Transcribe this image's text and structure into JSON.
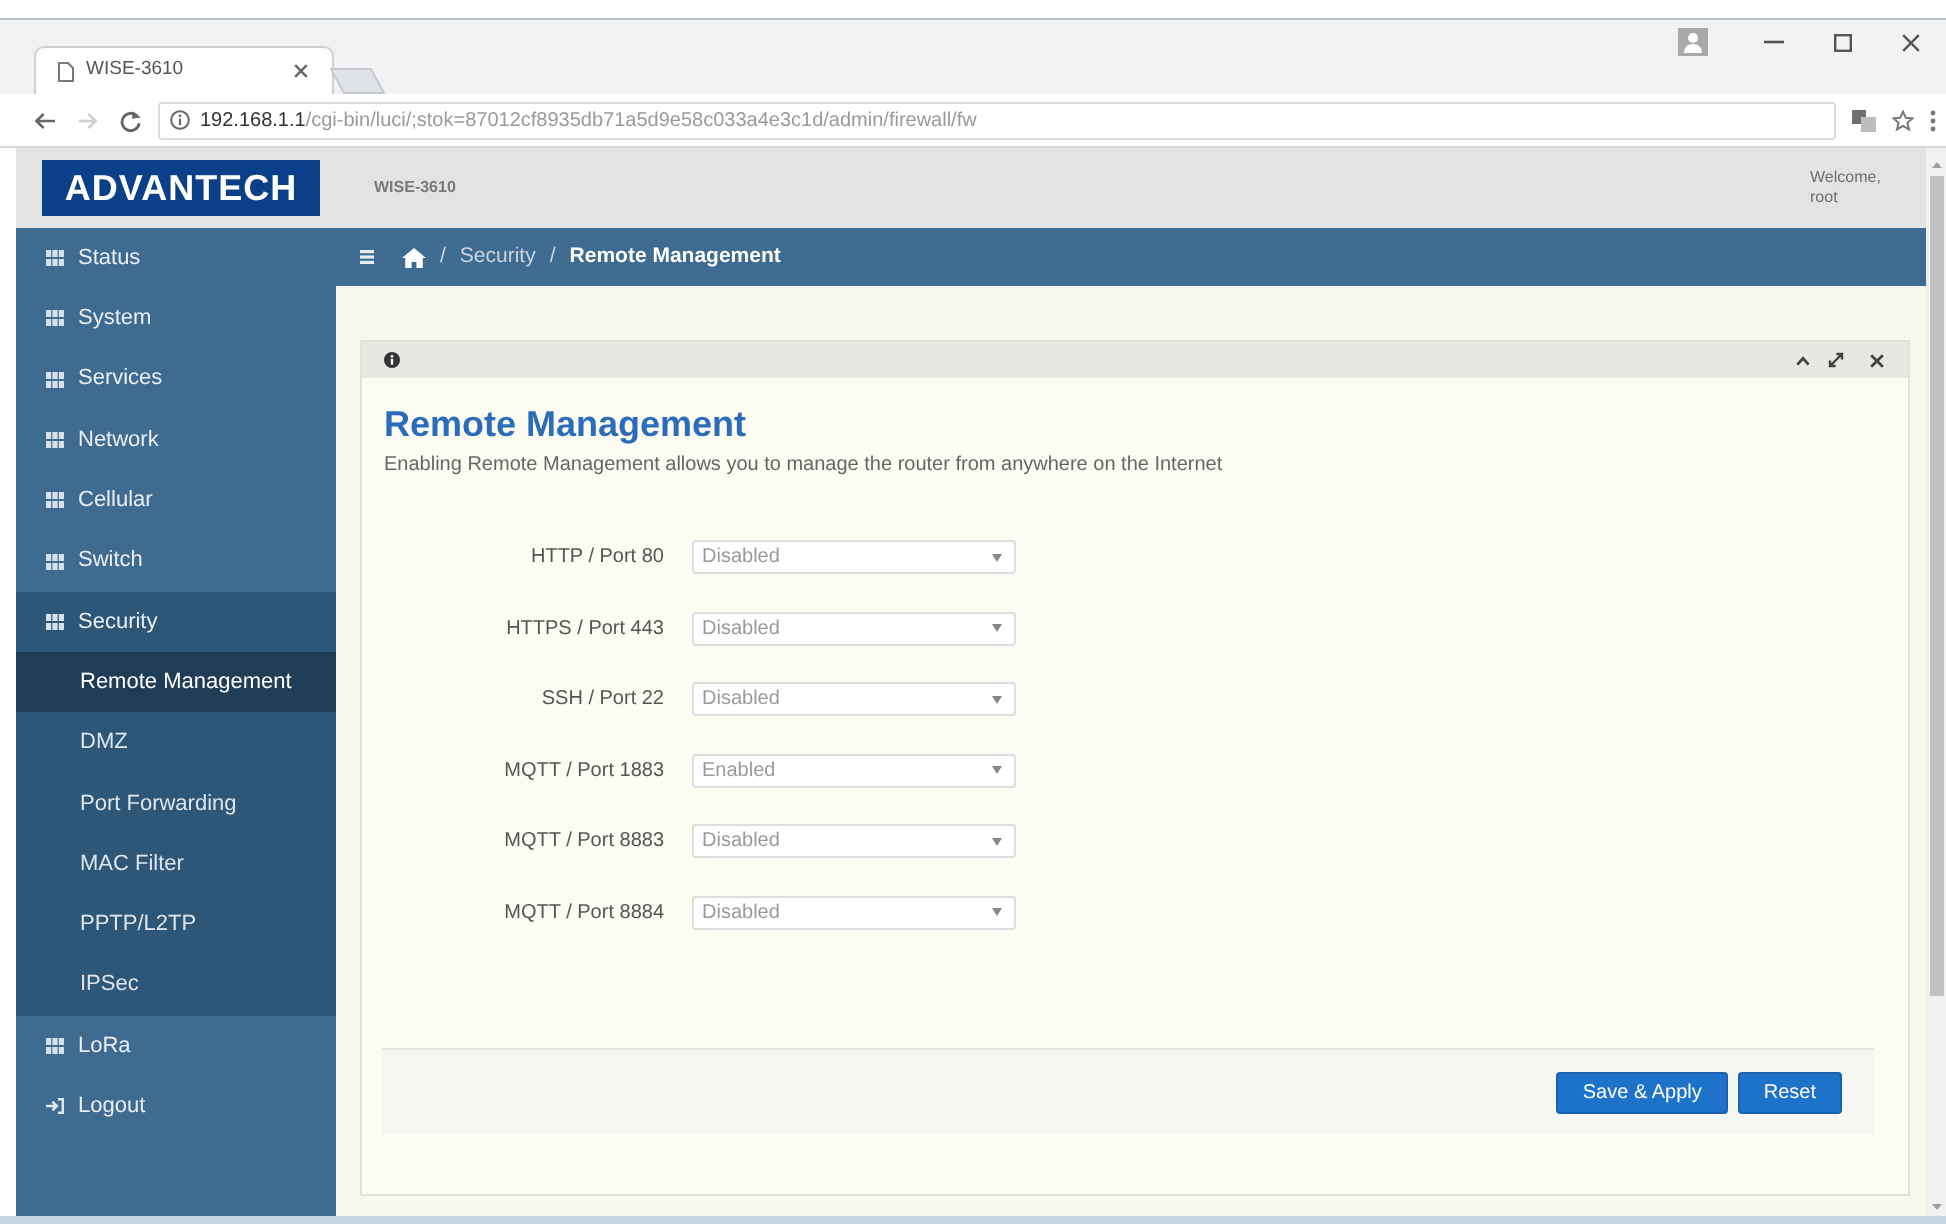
{
  "browser": {
    "tab": {
      "title": "WISE-3610"
    },
    "address_bar": {
      "host": "192.168.1.1",
      "path": "/cgi-bin/luci/;stok=87012cf8935db71a5d9e58c033a4e3c1d/admin/firewall/fw"
    }
  },
  "header": {
    "logo": "ADVANTECH",
    "device": "WISE-3610",
    "welcome": "Welcome, root"
  },
  "sidebar": {
    "items": [
      {
        "kind": "menu",
        "label": "Status",
        "expanded": false
      },
      {
        "kind": "menu",
        "label": "System",
        "expanded": false
      },
      {
        "kind": "menu",
        "label": "Services",
        "expanded": false
      },
      {
        "kind": "menu",
        "label": "Network",
        "expanded": false
      },
      {
        "kind": "menu",
        "label": "Cellular",
        "expanded": false
      },
      {
        "kind": "menu",
        "label": "Switch",
        "expanded": false
      },
      {
        "kind": "menu",
        "label": "Security",
        "expanded": true,
        "children": [
          {
            "label": "Remote Management",
            "selected": true
          },
          {
            "label": "DMZ",
            "selected": false
          },
          {
            "label": "Port Forwarding",
            "selected": false
          },
          {
            "label": "MAC Filter",
            "selected": false
          },
          {
            "label": "PPTP/L2TP",
            "selected": false
          },
          {
            "label": "IPSec",
            "selected": false
          }
        ]
      },
      {
        "kind": "menu",
        "label": "LoRa",
        "expanded": false
      },
      {
        "kind": "logout",
        "label": "Logout",
        "expanded": false
      }
    ]
  },
  "breadcrumb": [
    {
      "separator": "/",
      "label": "Security",
      "current": false
    },
    {
      "separator": "/",
      "label": "Remote Management",
      "current": true
    }
  ],
  "panel": {
    "title": "Remote Management",
    "description": "Enabling Remote Management allows you to manage the router from anywhere on the Internet",
    "fields": [
      {
        "label": "HTTP / Port 80",
        "value": "Disabled"
      },
      {
        "label": "HTTPS / Port 443",
        "value": "Disabled"
      },
      {
        "label": "SSH / Port 22",
        "value": "Disabled"
      },
      {
        "label": "MQTT / Port 1883",
        "value": "Enabled"
      },
      {
        "label": "MQTT / Port 8883",
        "value": "Disabled"
      },
      {
        "label": "MQTT / Port 8884",
        "value": "Disabled"
      }
    ],
    "buttons": [
      "Save & Apply",
      "Reset"
    ]
  }
}
